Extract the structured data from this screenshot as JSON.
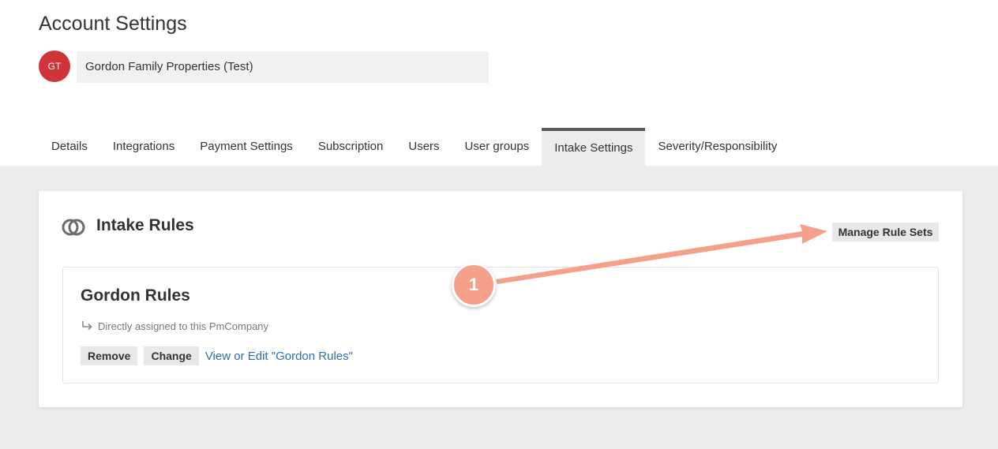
{
  "page": {
    "title": "Account Settings"
  },
  "account": {
    "avatar_initials": "GT",
    "avatar_color": "#d13438",
    "company_name": "Gordon Family Properties (Test)"
  },
  "tabs": [
    {
      "label": "Details",
      "active": false
    },
    {
      "label": "Integrations",
      "active": false
    },
    {
      "label": "Payment Settings",
      "active": false
    },
    {
      "label": "Subscription",
      "active": false
    },
    {
      "label": "Users",
      "active": false
    },
    {
      "label": "User groups",
      "active": false
    },
    {
      "label": "Intake Settings",
      "active": true
    },
    {
      "label": "Severity/Responsibility",
      "active": false
    }
  ],
  "intake": {
    "icon": "overlapping-circles-icon",
    "title": "Intake Rules",
    "manage_label": "Manage Rule Sets",
    "ruleset": {
      "name": "Gordon Rules",
      "assignment_icon": "return-arrow-icon",
      "assignment": "Directly assigned to this PmCompany",
      "remove_label": "Remove",
      "change_label": "Change",
      "edit_link": "View or Edit \"Gordon Rules\""
    }
  },
  "annotation": {
    "step_number": "1",
    "color": "#f5a08a"
  },
  "colors": {
    "link": "#2b6cb0",
    "active_tab_border": "#5c5c5c",
    "background": "#ececec"
  }
}
